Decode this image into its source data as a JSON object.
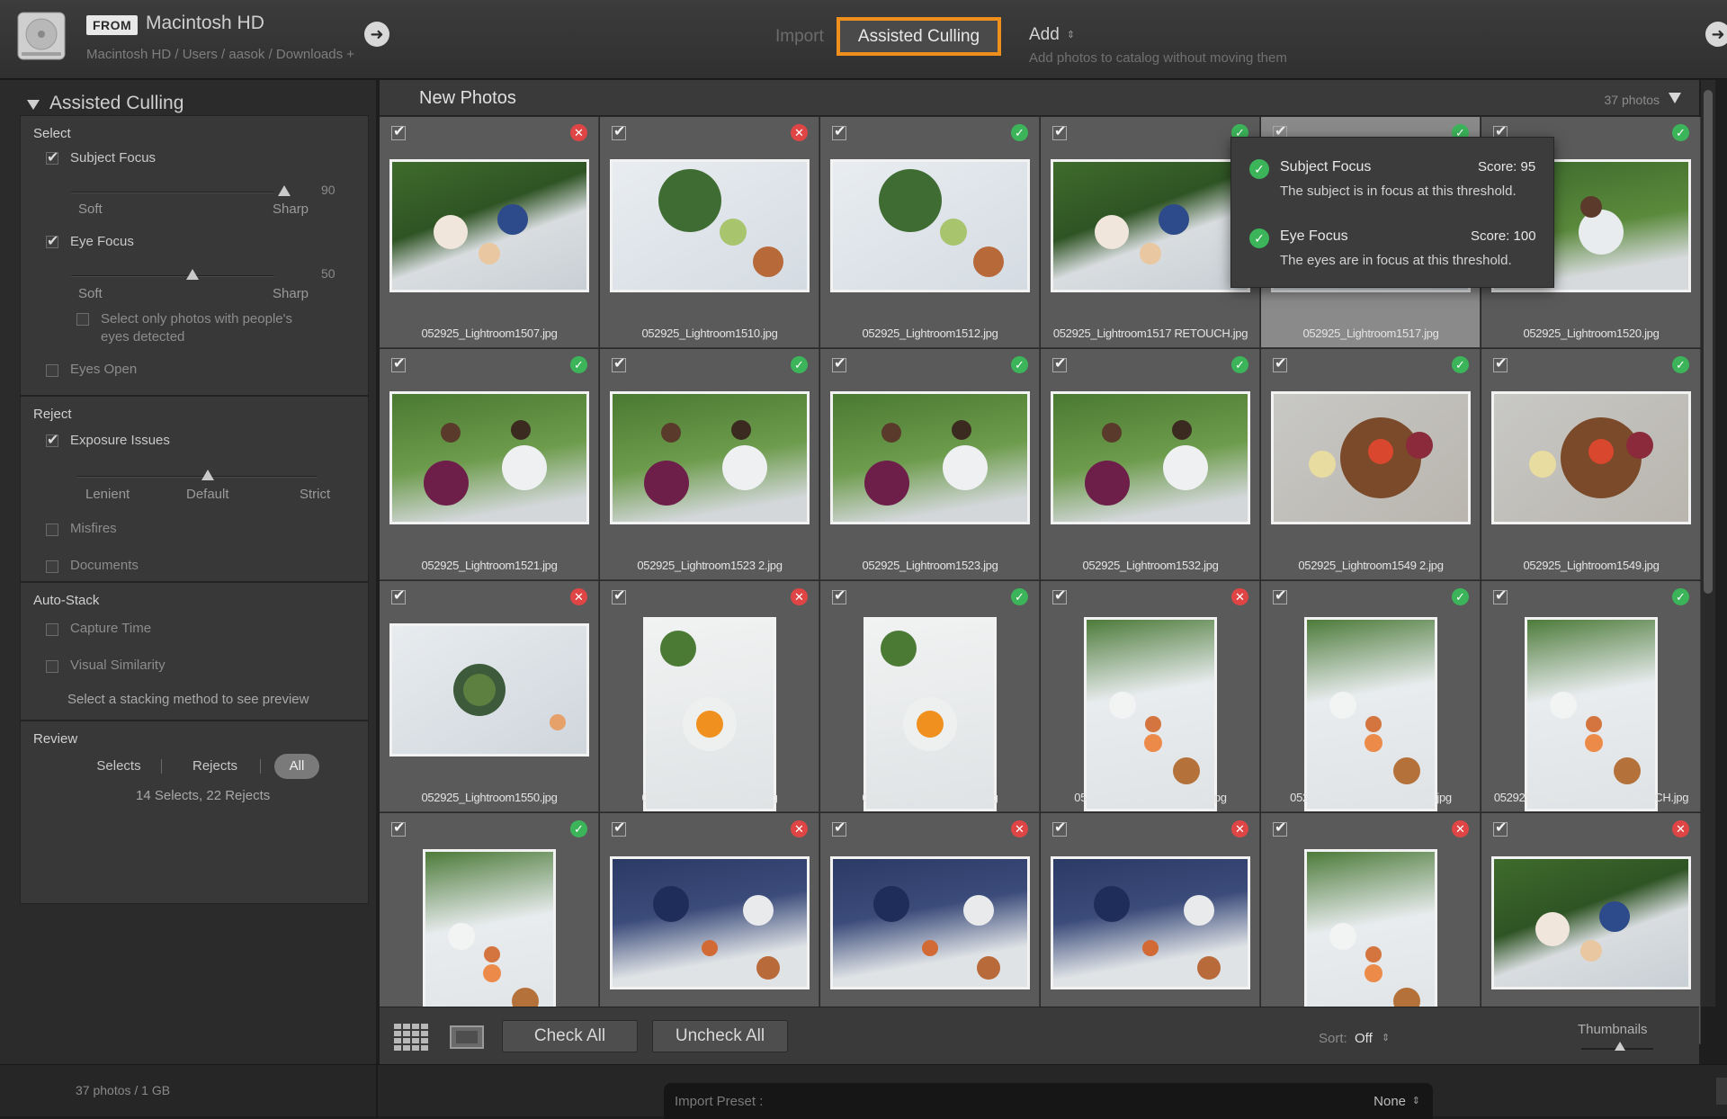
{
  "source": {
    "from_badge": "FROM",
    "title": "Macintosh HD",
    "path": "Macintosh HD / Users / aasok / Downloads +",
    "disk_icon": "hard-drive-icon",
    "go_icon": "arrow-right-icon"
  },
  "modes": {
    "import": "Import",
    "assisted_culling": "Assisted Culling",
    "add": "Add",
    "add_arrows": "⇕",
    "add_desc": "Add photos to catalog without moving them"
  },
  "panel": {
    "title": "Assisted Culling",
    "select": {
      "title": "Select",
      "subject_focus": {
        "label": "Subject Focus",
        "checked": true,
        "value": "90",
        "min_label": "Soft",
        "max_label": "Sharp"
      },
      "eye_focus": {
        "label": "Eye Focus",
        "checked": true,
        "value": "50",
        "min_label": "Soft",
        "max_label": "Sharp"
      },
      "people_only": {
        "label": "Select only photos with people's eyes detected",
        "checked": false
      },
      "eyes_open": {
        "label": "Eyes Open",
        "checked": false
      }
    },
    "reject": {
      "title": "Reject",
      "exposure_issues": {
        "label": "Exposure Issues",
        "checked": true,
        "lenient": "Lenient",
        "default": "Default",
        "strict": "Strict"
      },
      "misfires": {
        "label": "Misfires",
        "checked": false
      },
      "documents": {
        "label": "Documents",
        "checked": false
      }
    },
    "autostack": {
      "title": "Auto-Stack",
      "capture_time": {
        "label": "Capture Time",
        "checked": false
      },
      "visual_similarity": {
        "label": "Visual Similarity",
        "checked": false
      },
      "hint": "Select a stacking method to see preview"
    },
    "review": {
      "title": "Review",
      "selects": "Selects",
      "rejects": "Rejects",
      "all": "All",
      "summary": "14 Selects, 22 Rejects"
    }
  },
  "grid": {
    "header": "New Photos",
    "count": "37 photos",
    "photos": [
      {
        "name": "052925_Lightroom1507.jpg",
        "status": "reject",
        "kind": "dinner"
      },
      {
        "name": "052925_Lightroom1510.jpg",
        "status": "reject",
        "kind": "salad"
      },
      {
        "name": "052925_Lightroom1512.jpg",
        "status": "keep",
        "kind": "salad"
      },
      {
        "name": "052925_Lightroom1517 RETOUCH.jpg",
        "status": "keep",
        "kind": "dinner"
      },
      {
        "name": "052925_Lightroom1517.jpg",
        "status": "keep",
        "kind": "dinner",
        "selected": true
      },
      {
        "name": "052925_Lightroom1520.jpg",
        "status": "keep",
        "kind": "portrait"
      },
      {
        "name": "052925_Lightroom1521.jpg",
        "status": "keep",
        "kind": "couple"
      },
      {
        "name": "052925_Lightroom1523 2.jpg",
        "status": "keep",
        "kind": "couple"
      },
      {
        "name": "052925_Lightroom1523.jpg",
        "status": "keep",
        "kind": "couple"
      },
      {
        "name": "052925_Lightroom1532.jpg",
        "status": "keep",
        "kind": "couple"
      },
      {
        "name": "052925_Lightroom1549 2.jpg",
        "status": "keep",
        "kind": "board"
      },
      {
        "name": "052925_Lightroom1549.jpg",
        "status": "keep",
        "kind": "board"
      },
      {
        "name": "052925_Lightroom1550.jpg",
        "status": "reject",
        "kind": "bowl"
      },
      {
        "name": "052925_Lightroom1553.jpg",
        "status": "reject",
        "kind": "apricot",
        "portrait": true
      },
      {
        "name": "052925_Lightroom1554.jpg",
        "status": "keep",
        "kind": "apricot",
        "portrait": true
      },
      {
        "name": "052925_Lightroom1555 (1).jpg",
        "status": "reject",
        "kind": "bottle",
        "portrait": true
      },
      {
        "name": "052925_Lightroom1555 2 (1).jpg",
        "status": "keep",
        "kind": "bottle",
        "portrait": true
      },
      {
        "name": "052925_Lightroom1555 RETOUCH.jpg",
        "status": "keep",
        "kind": "bottle",
        "portrait": true
      },
      {
        "name": "",
        "status": "keep",
        "kind": "bottle",
        "portrait": true
      },
      {
        "name": "",
        "status": "reject",
        "kind": "group"
      },
      {
        "name": "",
        "status": "reject",
        "kind": "group"
      },
      {
        "name": "",
        "status": "reject",
        "kind": "group"
      },
      {
        "name": "",
        "status": "reject",
        "kind": "bottle",
        "portrait": true
      },
      {
        "name": "",
        "status": "reject",
        "kind": "dinner"
      }
    ]
  },
  "tooltip": {
    "subject_title": "Subject Focus",
    "subject_score": "Score: 95",
    "subject_desc": "The subject is in focus at this threshold.",
    "eye_title": "Eye Focus",
    "eye_score": "Score: 100",
    "eye_desc": "The eyes are in focus at this threshold."
  },
  "toolbar": {
    "check_all": "Check All",
    "uncheck_all": "Uncheck All",
    "sort_label": "Sort:",
    "sort_value": "Off",
    "sort_arrows": "⇕",
    "thumbnails_label": "Thumbnails"
  },
  "footer": {
    "info": "37 photos / 1 GB",
    "preset_label": "Import Preset :",
    "preset_value": "None",
    "preset_arrows": "⇕"
  }
}
